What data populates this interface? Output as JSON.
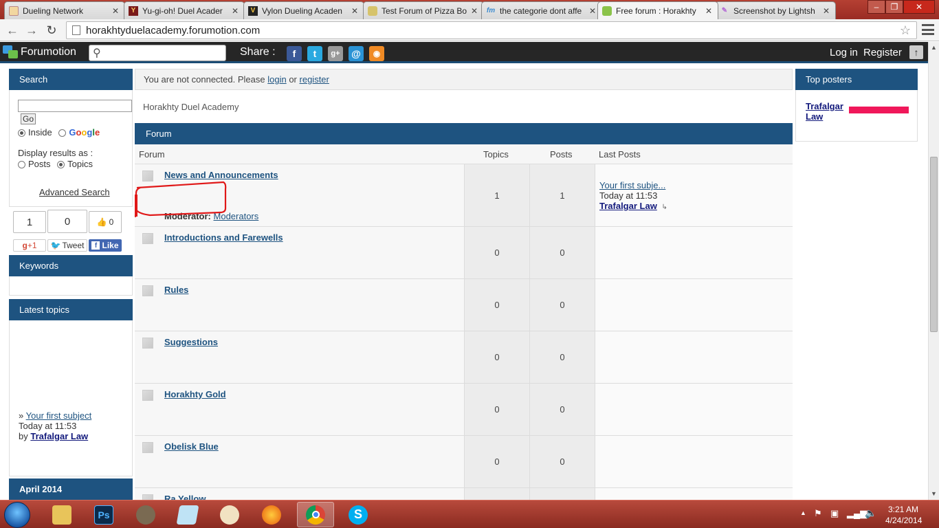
{
  "browser": {
    "tabs": [
      {
        "label": "Dueling Network",
        "favicon": "dn-favicon"
      },
      {
        "label": "Yu-gi-oh! Duel Acader",
        "favicon": "ygo-favicon"
      },
      {
        "label": "Vylon Dueling Acaden",
        "favicon": "vylon-favicon"
      },
      {
        "label": "Test Forum of Pizza Bo",
        "favicon": "forum-favicon"
      },
      {
        "label": "the categorie dont affe",
        "favicon": "fm-favicon"
      },
      {
        "label": "Free forum : Horakhty",
        "favicon": "forum-favicon",
        "active": true
      },
      {
        "label": "Screenshot by Lightsh",
        "favicon": "lightshot-favicon"
      }
    ],
    "url": "horakhtyduelacademy.forumotion.com"
  },
  "fm_toolbar": {
    "brand": "Forumotion",
    "share_label": "Share :",
    "login": "Log in",
    "register": "Register"
  },
  "search_panel": {
    "title": "Search",
    "go": "Go",
    "inside": "Inside",
    "google": [
      "G",
      "o",
      "o",
      "g",
      "l",
      "e"
    ],
    "display_label": "Display results as :",
    "posts": "Posts",
    "topics": "Topics",
    "advanced": "Advanced Search"
  },
  "social": {
    "gplus_count": "1",
    "tweet_count": "0",
    "like_count": "0",
    "gplus_label": "+1",
    "tweet_label": "Tweet",
    "like_label": "Like"
  },
  "keywords_panel": {
    "title": "Keywords"
  },
  "latest_panel": {
    "title": "Latest topics",
    "prefix": "»",
    "topic": "Your first subject",
    "time": "Today at 11:53",
    "by": "by",
    "author": "Trafalgar Law"
  },
  "calendar_panel": {
    "title": "April 2014"
  },
  "main": {
    "notice_pre": "You are not connected. Please",
    "notice_login": "login",
    "notice_or": "or",
    "notice_register": "register",
    "site_title": "Horakhty Duel Academy",
    "category": "Forum",
    "col_forum": "Forum",
    "col_topics": "Topics",
    "col_posts": "Posts",
    "col_last": "Last Posts",
    "forums": [
      {
        "name": "News and Announcements",
        "topics": "1",
        "posts": "1",
        "moderator_label": "Moderator:",
        "moderator": "Moderators",
        "last_title": "Your first subje...",
        "last_time": "Today at 11:53",
        "last_author": "Trafalgar Law"
      },
      {
        "name": "Introductions and Farewells",
        "topics": "0",
        "posts": "0"
      },
      {
        "name": "Rules",
        "topics": "0",
        "posts": "0"
      },
      {
        "name": "Suggestions",
        "topics": "0",
        "posts": "0"
      },
      {
        "name": "Horakhty Gold",
        "topics": "0",
        "posts": "0"
      },
      {
        "name": "Obelisk Blue",
        "topics": "0",
        "posts": "0"
      },
      {
        "name": "Ra Yellow",
        "topics": "",
        "posts": ""
      }
    ]
  },
  "top_posters": {
    "title": "Top posters",
    "user_line1": "Trafalgar",
    "user_line2": "Law",
    "bar_color": "#f0185a"
  },
  "taskbar": {
    "time": "3:21 AM",
    "date": "4/24/2014"
  },
  "colors": {
    "header_blue": "#1e5380",
    "toolbar_dark": "#262626",
    "annotation_red": "#e01818"
  }
}
